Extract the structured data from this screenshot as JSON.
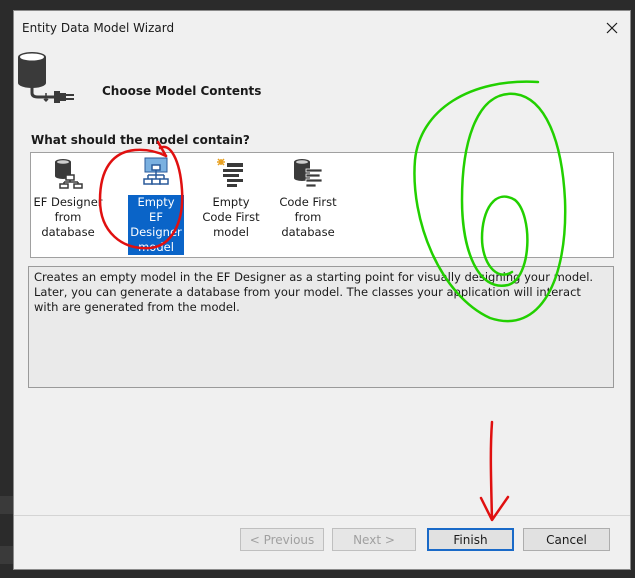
{
  "window": {
    "title": "Entity Data Model Wizard",
    "close_icon": "close-icon"
  },
  "header": {
    "title": "Choose Model Contents",
    "icon": "database-plug-icon"
  },
  "model_section": {
    "label": "What should the model contain?",
    "items": [
      {
        "label": "EF Designer from database",
        "icon": "database-model-icon",
        "selected": false
      },
      {
        "label": "Empty EF Designer model",
        "icon": "empty-model-icon",
        "selected": true
      },
      {
        "label": "Empty Code First model",
        "icon": "code-first-icon",
        "selected": false
      },
      {
        "label": "Code First from database",
        "icon": "code-first-database-icon",
        "selected": false
      }
    ]
  },
  "description": "Creates an empty model in the EF Designer as a starting point for visually designing your model. Later, you can generate a database from your model. The classes your application will interact with are generated from the model.",
  "buttons": {
    "previous": "< Previous",
    "next": "Next >",
    "finish": "Finish",
    "cancel": "Cancel"
  },
  "colors": {
    "selection": "#0a64c8",
    "annotation_red": "#e01010",
    "annotation_green": "#22d000"
  }
}
